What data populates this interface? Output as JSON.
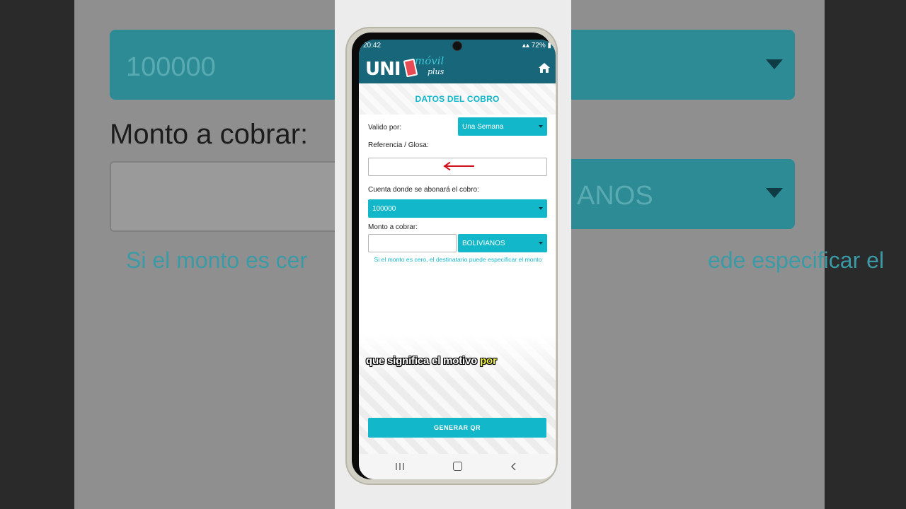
{
  "background": {
    "account_value": "100000",
    "amount_label": "Monto a cobrar:",
    "currency_partial": "ANOS",
    "help_left": "Si el monto es cer",
    "help_right": "ede especificar el"
  },
  "status_bar": {
    "time": "20:42",
    "battery": "72%"
  },
  "app_header": {
    "logo_main": "UNI",
    "logo_sub": "móvil",
    "logo_plus": "plus"
  },
  "form": {
    "title": "DATOS DEL COBRO",
    "valid_label": "Valido por:",
    "valid_value": "Una Semana",
    "reference_label": "Referencia / Glosa:",
    "reference_value": "",
    "account_label": "Cuenta donde se abonará el cobro:",
    "account_value": "100000",
    "amount_label": "Monto a cobrar:",
    "amount_value": "",
    "currency_value": "BOLIVIANOS",
    "help_text": "Si el monto es cero, el destinatario puede especificar el monto",
    "submit_label": "GENERAR QR"
  },
  "caption": {
    "text": "que significa el motivo ",
    "highlight": "por"
  },
  "colors": {
    "header": "#17667a",
    "accent": "#12b7c9",
    "arrow": "#d0101a"
  }
}
